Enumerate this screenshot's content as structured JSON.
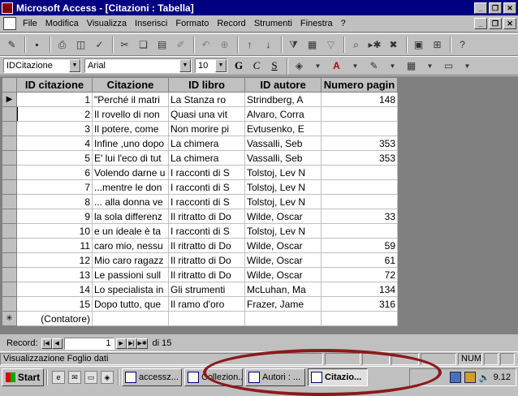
{
  "window": {
    "title": "Microsoft Access - [Citazioni : Tabella]",
    "controls": [
      "_",
      "❐",
      "✕"
    ],
    "mdi_controls": [
      "_",
      "❐",
      "✕"
    ]
  },
  "menu": [
    "File",
    "Modifica",
    "Visualizza",
    "Inserisci",
    "Formato",
    "Record",
    "Strumenti",
    "Finestra",
    "?"
  ],
  "toolbar2": {
    "field_combo": "IDCitazione",
    "font_combo": "Arial",
    "size_combo": "10",
    "bold": "G",
    "italic": "C",
    "underline": "S"
  },
  "table": {
    "columns": [
      "ID citazione",
      "Citazione",
      "ID libro",
      "ID autore",
      "Numero pagin"
    ],
    "rows": [
      [
        "1",
        "\"Perché il matri",
        "La Stanza ro",
        "Strindberg, A",
        "148"
      ],
      [
        "2",
        "Il rovello di non",
        "Quasi una vit",
        "Alvaro, Corra",
        ""
      ],
      [
        "3",
        "Il potere, come",
        "Non morire pi",
        "Evtusenko, E",
        ""
      ],
      [
        "4",
        "Infine ,uno dopo",
        "La chimera",
        "Vassalli, Seb",
        "353"
      ],
      [
        "5",
        "E' lui l'eco di tut",
        "La chimera",
        "Vassalli, Seb",
        "353"
      ],
      [
        "6",
        "Volendo darne u",
        "I racconti di S",
        "Tolstoj, Lev N",
        ""
      ],
      [
        "7",
        "...mentre le don",
        "I racconti di S",
        "Tolstoj, Lev N",
        ""
      ],
      [
        "8",
        "... alla donna ve",
        "I racconti di S",
        "Tolstoj, Lev N",
        ""
      ],
      [
        "9",
        "la sola differenz",
        "Il ritratto di Do",
        "Wilde, Oscar",
        "33"
      ],
      [
        "10",
        "e un ideale è ta",
        "I racconti di S",
        "Tolstoj, Lev N",
        ""
      ],
      [
        "11",
        "caro mio, nessu",
        "Il ritratto di Do",
        "Wilde, Oscar",
        "59"
      ],
      [
        "12",
        "Mio caro ragazz",
        "Il ritratto di Do",
        "Wilde, Oscar",
        "61"
      ],
      [
        "13",
        "Le passioni sull",
        "Il ritratto di Do",
        "Wilde, Oscar",
        "72"
      ],
      [
        "14",
        "Lo specialista in",
        "Gli strumenti",
        "McLuhan, Ma",
        "134"
      ],
      [
        "15",
        "Dopo tutto, que",
        "Il ramo d'oro",
        "Frazer, Jame",
        "316"
      ]
    ],
    "new_row": "(Contatore)",
    "current_marker": "▶",
    "new_marker": "✳"
  },
  "navigation": {
    "label": "Record:",
    "current": "1",
    "total_text": "di 15"
  },
  "status": {
    "text": "Visualizzazione Foglio dati",
    "num": "NUM"
  },
  "taskbar": {
    "start": "Start",
    "tasks": [
      "accessz...",
      "Collezion...",
      "Autori : ...",
      "Citazio..."
    ],
    "clock": "9.12"
  },
  "colors": {
    "titlebar": "#000080",
    "chrome": "#c0c0c0",
    "annotation_ellipse": "#8b1a1a"
  }
}
